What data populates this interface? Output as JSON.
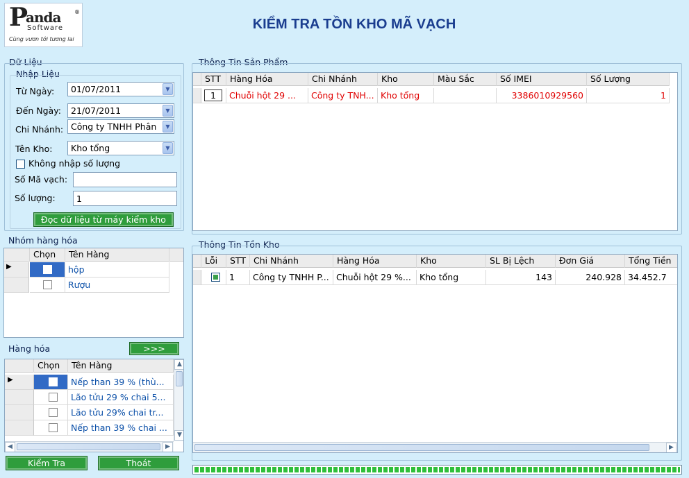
{
  "header": {
    "title": "KIỂM TRA TỒN KHO MÃ VẠCH",
    "logo": {
      "brand": "anda",
      "brand_initial": "P",
      "sub": "Software",
      "registered": "®",
      "slogan": "Cùng vươn tới tương lai"
    }
  },
  "left_panel": {
    "group_title": "Dữ Liệu",
    "input_group_title": "Nhập Liệu",
    "from_date_label": "Từ Ngày:",
    "from_date_value": "01/07/2011",
    "to_date_label": "Đến Ngày:",
    "to_date_value": "21/07/2011",
    "branch_label": "Chi Nhánh:",
    "branch_value": "Công ty TNHH Phân",
    "warehouse_label": "Tên Kho:",
    "warehouse_value": "Kho tổng",
    "no_qty_label": "Không nhập số lượng",
    "barcode_label": "Số Mã vạch:",
    "barcode_value": "",
    "qty_label": "Số lượng:",
    "qty_value": "1",
    "read_button": "Đọc dữ liệu từ máy kiểm kho"
  },
  "group_grid": {
    "title": "Nhóm hàng hóa",
    "headers": [
      "Chọn",
      "Tên Hàng"
    ],
    "rows": [
      {
        "name": "hộp"
      },
      {
        "name": "Rượu"
      }
    ]
  },
  "goods_grid": {
    "title": "Hàng hóa",
    "move_button": ">>>",
    "headers": [
      "Chọn",
      "Tên Hàng"
    ],
    "rows": [
      {
        "name": "Nếp than 39 % (thù..."
      },
      {
        "name": "Lão tửu 29 % chai 5..."
      },
      {
        "name": "Lão tửu 29% chai tr..."
      },
      {
        "name": "Nếp than 39 % chai ..."
      }
    ]
  },
  "bottom_buttons": {
    "check": "Kiểm Tra",
    "exit": "Thoát"
  },
  "product_info": {
    "title": "Thông Tin Sản Phẩm",
    "headers": [
      "STT",
      "Hàng Hóa",
      "Chi Nhánh",
      "Kho",
      "Màu Sắc",
      "Số IMEI",
      "Số Lượng"
    ],
    "rows": [
      {
        "stt": "1",
        "goods": "Chuỗi hột 29 ...",
        "branch": "Công ty TNH...",
        "warehouse": "Kho tổng",
        "color": "",
        "imei": "3386010929560",
        "qty": "1"
      }
    ]
  },
  "stock_info": {
    "title": "Thông Tin Tồn Kho",
    "headers": [
      "Lỗi",
      "STT",
      "Chi Nhánh",
      "Hàng Hóa",
      "Kho",
      "SL Bị Lệch",
      "Đơn Giá",
      "Tổng Tiền"
    ],
    "rows": [
      {
        "stt": "1",
        "branch": "Công ty TNHH P...",
        "goods": "Chuỗi hột 29 %...",
        "warehouse": "Kho tổng",
        "diff": "143",
        "price": "240.928",
        "total": "34.452.7"
      }
    ]
  },
  "progress": {
    "value": 1.0
  },
  "colors": {
    "accent_green": "#2f9d3c",
    "title_blue": "#1a3d8f",
    "error_red": "#e00000",
    "background": "#d4eefb"
  }
}
